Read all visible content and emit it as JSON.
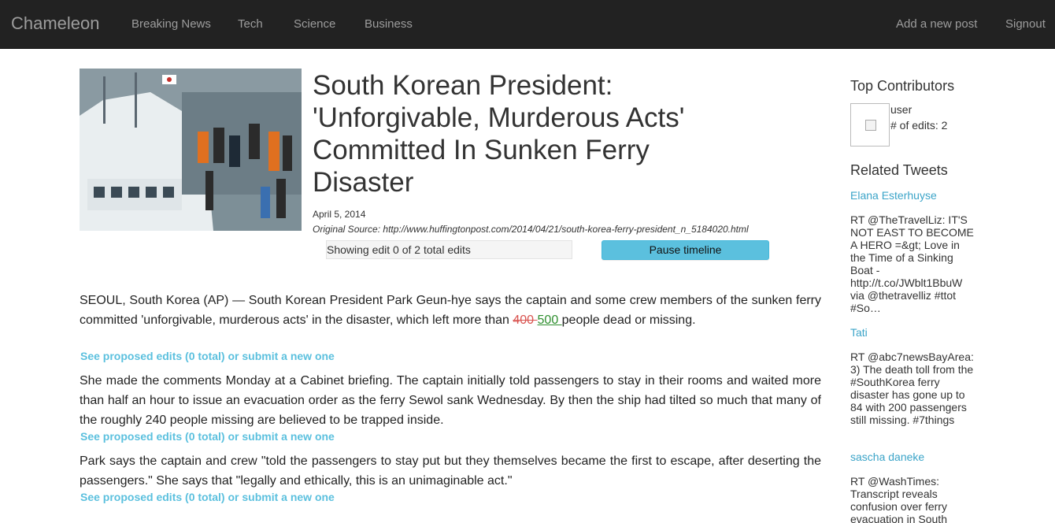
{
  "navbar": {
    "brand": "Chameleon",
    "links": [
      "Breaking News",
      "Tech",
      "Science",
      "Business"
    ],
    "add_post": "Add a new post",
    "signout": "Signout"
  },
  "article": {
    "title": "South Korean President: 'Unforgivable, Murderous Acts' Committed In Sunken Ferry Disaster",
    "date": "April 5, 2014",
    "source_label": "Original Source:",
    "source_url": "http://www.huffingtonpost.com/2014/04/21/south-korea-ferry-president_n_5184020.html",
    "edit_status": "Showing edit 0 of 2 total edits",
    "timeline_button": "Pause timeline",
    "paragraphs": [
      {
        "before": "SEOUL, South Korea (AP) — South Korean President Park Geun-hye says the captain and some crew members of the sunken ferry committed 'unforgivable, murderous acts' in the disaster, which left more than ",
        "deleted": "400 ",
        "inserted": "500 ",
        "after": "people dead or missing.",
        "edits_link": "See proposed edits (0 total) or submit a new one"
      },
      {
        "text": "She made the comments Monday at a Cabinet briefing. The captain initially told passengers to stay in their rooms and waited more than half an hour to issue an evacuation order as the ferry Sewol sank Wednesday. By then the ship had tilted so much that many of the roughly 240 people missing are believed to be trapped inside.",
        "edits_link": "See proposed edits (0 total) or submit a new one"
      },
      {
        "text": "Park says the captain and crew \"told the passengers to stay put but they themselves became the first to escape, after deserting the passengers.\" She says that \"legally and ethically, this is an unimaginable act.\"",
        "edits_link": "See proposed edits (0 total) or submit a new one"
      }
    ]
  },
  "sidebar": {
    "contributors_heading": "Top Contributors",
    "contributor": {
      "name": "user",
      "edits": "# of edits: 2"
    },
    "tweets_heading": "Related Tweets",
    "tweets": [
      {
        "user": "Elana Esterhuyse",
        "text": "RT @TheTravelLiz: IT'S NOT EAST TO BECOME A HERO =&gt; Love in the Time of a Sinking Boat - http://t.co/JWblt1BbuW via @thetravelliz #ttot #So…"
      },
      {
        "user": "Tati",
        "text": "RT @abc7newsBayArea: 3) The death toll from the #SouthKorea ferry disaster has gone up to 84 with 200 passengers still missing. #7things"
      },
      {
        "user": "sascha daneke",
        "text": "RT @WashTimes: Transcript reveals confusion over ferry evacuation in South"
      }
    ]
  },
  "colors": {
    "navbar_bg": "#222222",
    "accent": "#5bc0de",
    "deleted": "#d9534f",
    "inserted": "#2f8f2f"
  }
}
